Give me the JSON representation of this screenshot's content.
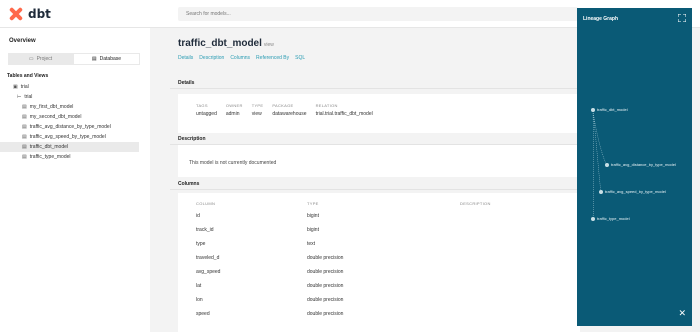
{
  "app": {
    "logo_text": "dbt"
  },
  "search": {
    "placeholder": "Search for models..."
  },
  "sidebar": {
    "title": "Overview",
    "toggle": {
      "project": "Project",
      "database": "Database"
    },
    "section": "Tables and Views",
    "tree": [
      {
        "label": "trial",
        "level": 0,
        "icon": "database-icon"
      },
      {
        "label": "trial",
        "level": 1,
        "icon": "schema-icon"
      },
      {
        "label": "my_first_dbt_model",
        "level": 2,
        "icon": "table-icon"
      },
      {
        "label": "my_second_dbt_model",
        "level": 2,
        "icon": "table-icon"
      },
      {
        "label": "traffic_avg_distance_by_type_model",
        "level": 2,
        "icon": "table-icon"
      },
      {
        "label": "traffic_avg_speed_by_type_model",
        "level": 2,
        "icon": "table-icon"
      },
      {
        "label": "traffic_dbt_model",
        "level": 2,
        "icon": "table-icon",
        "selected": true
      },
      {
        "label": "traffic_type_model",
        "level": 2,
        "icon": "table-icon"
      }
    ]
  },
  "main": {
    "model_name": "traffic_dbt_model",
    "model_type": "view",
    "tabs": [
      "Details",
      "Description",
      "Columns",
      "Referenced By",
      "SQL"
    ],
    "details": {
      "header": "Details",
      "fields": [
        {
          "key": "TAGS",
          "value": "untagged"
        },
        {
          "key": "OWNER",
          "value": "admin"
        },
        {
          "key": "TYPE",
          "value": "view"
        },
        {
          "key": "PACKAGE",
          "value": "datawarehouse"
        },
        {
          "key": "RELATION",
          "value": "trial.trial.traffic_dbt_model"
        }
      ]
    },
    "description": {
      "header": "Description",
      "text": "This model is not currently documented"
    },
    "columns": {
      "header": "Columns",
      "headings": [
        "COLUMN",
        "TYPE",
        "DESCRIPTION"
      ],
      "rows": [
        {
          "name": "id",
          "type": "bigint"
        },
        {
          "name": "track_id",
          "type": "bigint"
        },
        {
          "name": "type",
          "type": "text"
        },
        {
          "name": "traveled_d",
          "type": "double precision"
        },
        {
          "name": "avg_speed",
          "type": "double precision"
        },
        {
          "name": "lat",
          "type": "double precision"
        },
        {
          "name": "lon",
          "type": "double precision"
        },
        {
          "name": "speed",
          "type": "double precision"
        }
      ]
    }
  },
  "lineage": {
    "title": "Lineage Graph",
    "nodes": [
      "traffic_dbt_model",
      "traffic_avg_distance_by_type_model",
      "traffic_avg_speed_by_type_model",
      "traffic_type_model"
    ]
  }
}
